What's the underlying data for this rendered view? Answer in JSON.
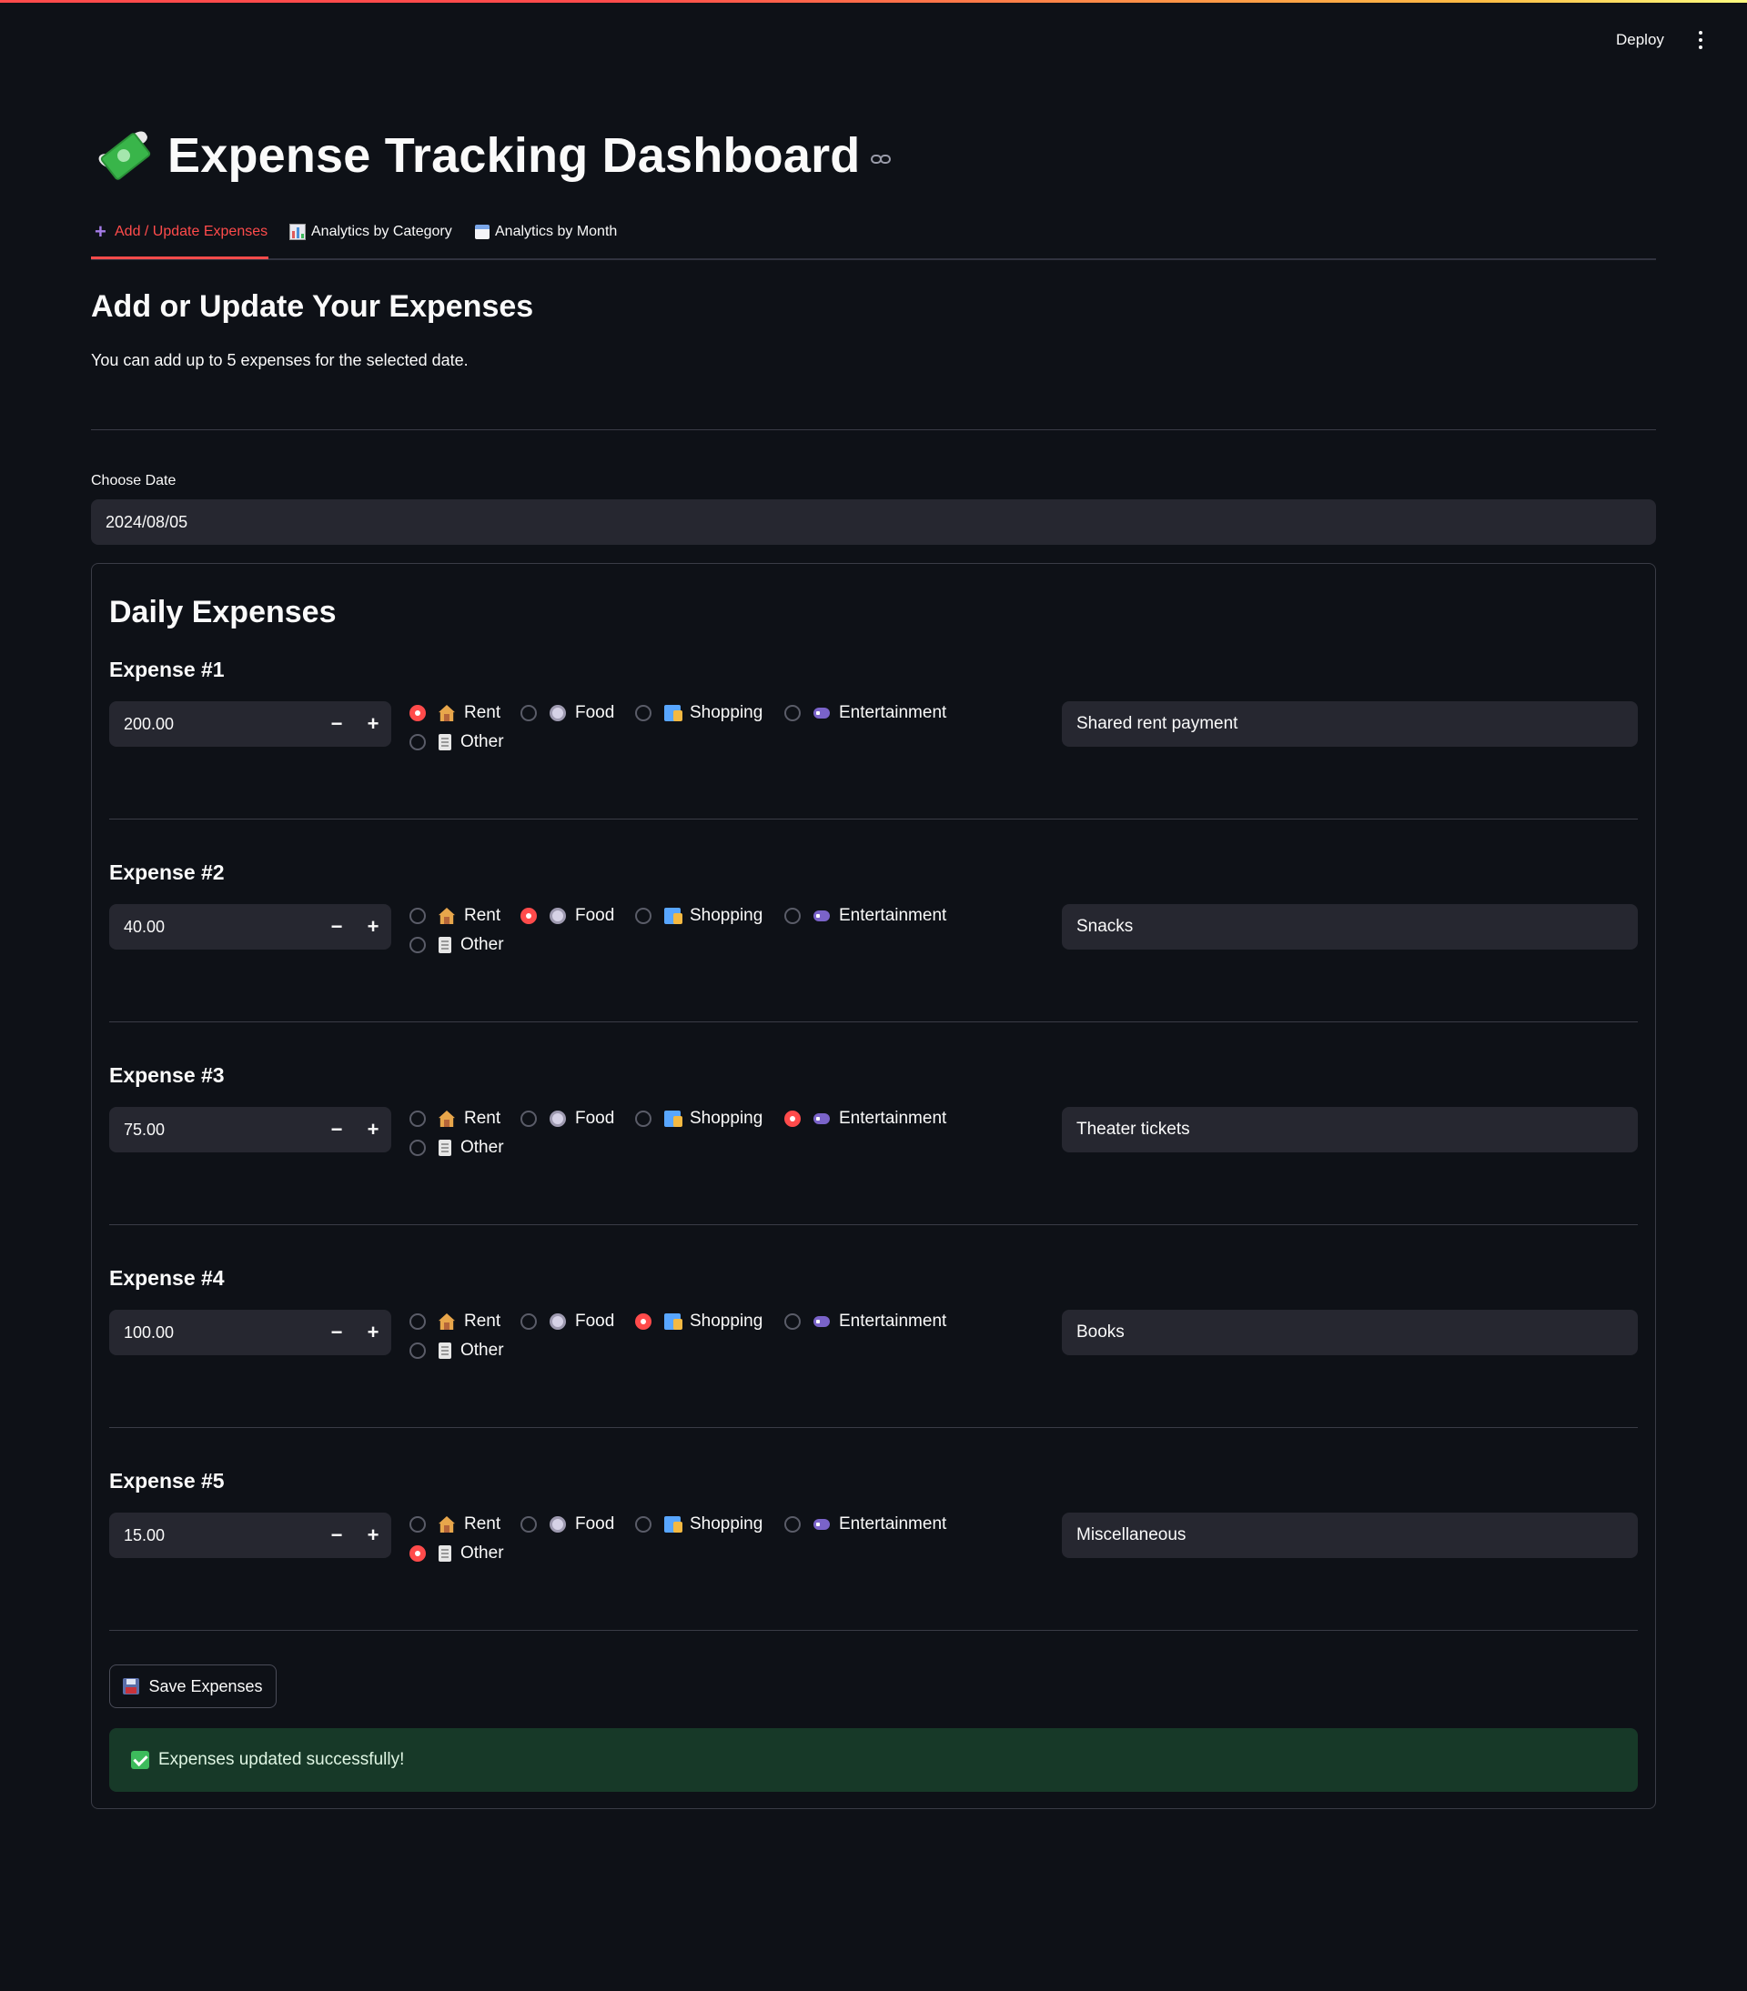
{
  "header": {
    "deploy_label": "Deploy"
  },
  "page": {
    "title": "Expense Tracking Dashboard"
  },
  "tabs": [
    {
      "label": "Add / Update Expenses",
      "icon": "plus-icon",
      "active": true
    },
    {
      "label": "Analytics by Category",
      "icon": "bar-chart-icon",
      "active": false
    },
    {
      "label": "Analytics by Month",
      "icon": "calendar-icon",
      "active": false
    }
  ],
  "add_section": {
    "heading": "Add or Update Your Expenses",
    "description": "You can add up to 5 expenses for the selected date.",
    "date_label": "Choose Date",
    "date_value": "2024/08/05"
  },
  "daily": {
    "heading": "Daily Expenses",
    "categories": [
      "Rent",
      "Food",
      "Shopping",
      "Entertainment",
      "Other"
    ],
    "expenses": [
      {
        "label": "Expense #1",
        "amount": "200.00",
        "category": "Rent",
        "note": "Shared rent payment"
      },
      {
        "label": "Expense #2",
        "amount": "40.00",
        "category": "Food",
        "note": "Snacks"
      },
      {
        "label": "Expense #3",
        "amount": "75.00",
        "category": "Entertainment",
        "note": "Theater tickets"
      },
      {
        "label": "Expense #4",
        "amount": "100.00",
        "category": "Shopping",
        "note": "Books"
      },
      {
        "label": "Expense #5",
        "amount": "15.00",
        "category": "Other",
        "note": "Miscellaneous"
      }
    ],
    "minus_symbol": "−",
    "plus_symbol": "+"
  },
  "actions": {
    "save_label": "Save Expenses",
    "success_message": "Expenses updated successfully!"
  },
  "colors": {
    "background": "#0e1117",
    "accent": "#ff4b4b",
    "input_bg": "#262730",
    "success_bg": "#173928"
  }
}
